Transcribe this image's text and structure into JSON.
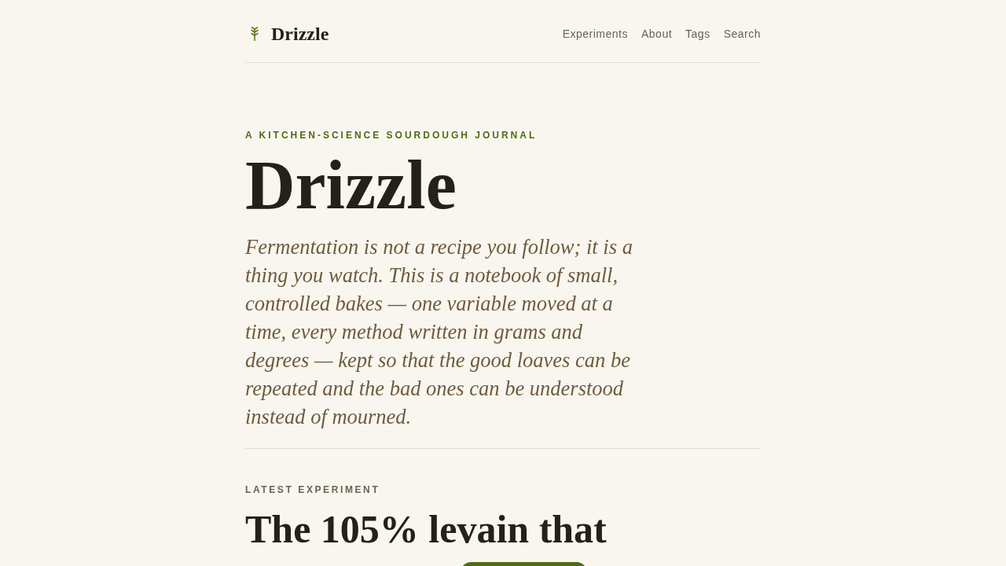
{
  "header": {
    "logo": "Drizzle",
    "nav": [
      "Experiments",
      "About",
      "Tags",
      "Search"
    ]
  },
  "hero": {
    "eyebrow": "A KITCHEN-SCIENCE SOURDOUGH JOURNAL",
    "title": "Drizzle",
    "lead": "Fermentation is not a recipe you follow; it is a thing you watch. This is a notebook of small, controlled bakes — one variable moved at a time, every method written in grams and degrees — kept so that the good loaves can be repeated and the bad ones can be understood instead of mourned."
  },
  "latest": {
    "label": "LATEST EXPERIMENT",
    "title": "The 105% levain that"
  }
}
